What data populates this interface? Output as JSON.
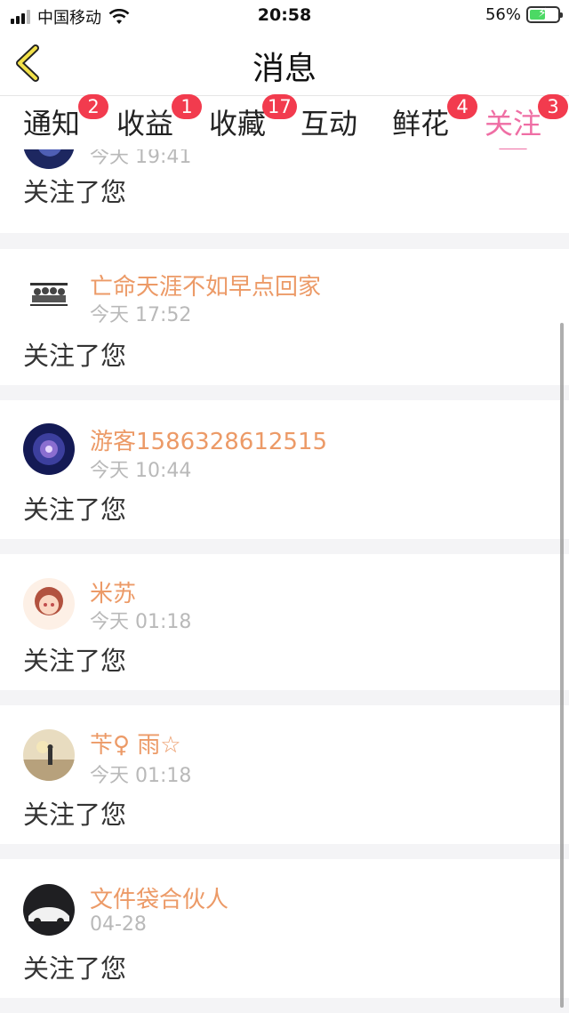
{
  "status_bar": {
    "carrier": "中国移动",
    "time": "20:58",
    "battery": "56%"
  },
  "header": {
    "title": "消息"
  },
  "tabs": [
    {
      "label": "通知",
      "badge": "2"
    },
    {
      "label": "收益",
      "badge": "1"
    },
    {
      "label": "收藏",
      "badge": "17"
    },
    {
      "label": "互动",
      "badge": ""
    },
    {
      "label": "鲜花",
      "badge": "4"
    },
    {
      "label": "关注",
      "badge": "3",
      "active": true
    }
  ],
  "items": [
    {
      "user": "",
      "time": "今天 19:41",
      "message": "关注了您"
    },
    {
      "user": "亡命天涯不如早点回家",
      "time": "今天 17:52",
      "message": "关注了您"
    },
    {
      "user": "游客1586328612515",
      "time": "今天 10:44",
      "message": "关注了您"
    },
    {
      "user": "米苏",
      "time": "今天 01:18",
      "message": "关注了您"
    },
    {
      "user": "苄♀ 雨☆",
      "time": "今天 01:18",
      "message": "关注了您"
    },
    {
      "user": "文件袋合伙人",
      "time": "04-28",
      "message": "关注了您"
    }
  ],
  "colors": {
    "accent": "#ef6ea4",
    "badge": "#f23b4e",
    "username": "#ec9a67"
  }
}
